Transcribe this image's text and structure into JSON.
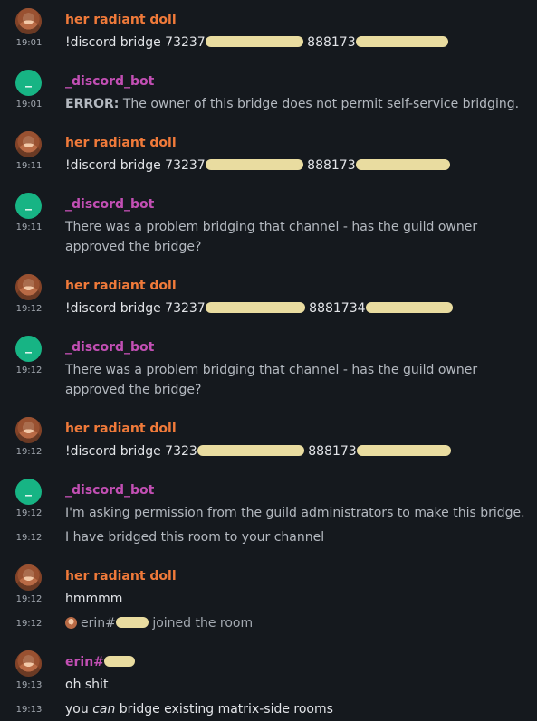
{
  "senders": {
    "user": "her radiant doll",
    "bot": "_discord_bot",
    "erin": "erin#"
  },
  "bot_avatar_letter": "_",
  "events": [
    {
      "time": "19:01",
      "command": "!discord bridge 73237",
      "guild_id": "888173"
    },
    {
      "time": "19:01",
      "error_label": "ERROR:",
      "text": "The owner of this bridge does not permit self-service bridging."
    },
    {
      "time": "19:11",
      "command": "!discord bridge 73237",
      "guild_id": "888173"
    },
    {
      "time": "19:11",
      "text": "There was a problem bridging that channel - has the guild owner approved the bridge?"
    },
    {
      "time": "19:12",
      "command": "!discord bridge 73237",
      "guild_id": "8881734"
    },
    {
      "time": "19:12",
      "text": "There was a problem bridging that channel - has the guild owner approved the bridge?"
    },
    {
      "time": "19:12",
      "command": "!discord bridge 7323",
      "guild_id": "888173"
    },
    {
      "time": "19:12",
      "text": "I'm asking permission from the guild administrators to make this bridge."
    },
    {
      "time": "19:12",
      "text": "I have bridged this room to your channel"
    },
    {
      "time": "19:12",
      "text": "hmmmm"
    },
    {
      "time": "19:12",
      "member": "erin#",
      "text": "joined the room"
    },
    {
      "time": "19:13",
      "text": "oh shit"
    },
    {
      "time": "19:13",
      "text_before": "you",
      "text_em": "can",
      "text_after": "bridge existing matrix-side rooms"
    }
  ],
  "colors": {
    "background": "#15191e",
    "user_name": "#f07a3a",
    "bot_name": "#c24fb4",
    "bot_avatar": "#17b484",
    "redaction": "#e9dca0"
  }
}
